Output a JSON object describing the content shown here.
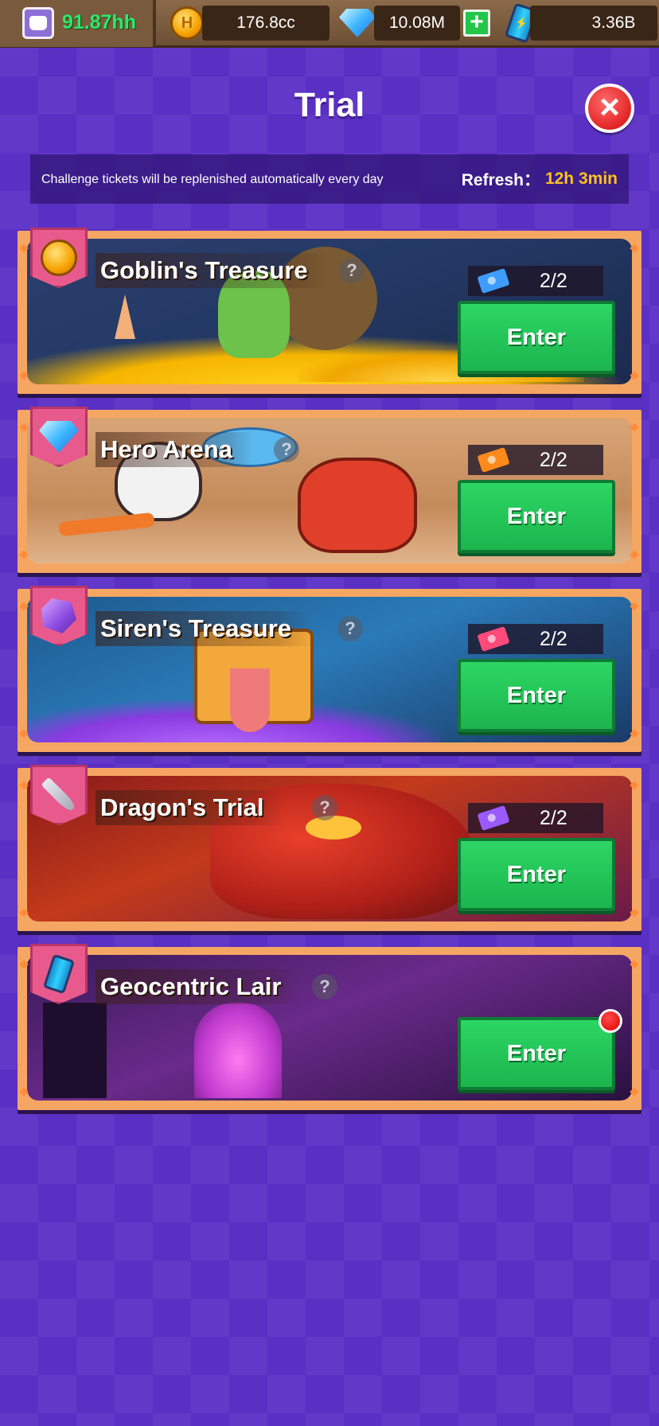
{
  "top_bar": {
    "power": "91.87hh",
    "coins": "176.8cc",
    "gems": "10.08M",
    "energy": "3.36B",
    "colors": {
      "power": "#2de86a"
    }
  },
  "header": {
    "title": "Trial",
    "info": "Challenge tickets will be replenished automatically every day",
    "refresh_label": "Refresh：",
    "refresh_time": "12h 3min"
  },
  "cards": [
    {
      "title": "Goblin's Treasure",
      "tickets": "2/2",
      "enter_label": "Enter",
      "badge_icon": "coin-icon",
      "ticket_color": "#3f9cff"
    },
    {
      "title": "Hero Arena",
      "tickets": "2/2",
      "enter_label": "Enter",
      "badge_icon": "gem-icon",
      "ticket_color": "#ff8a1a"
    },
    {
      "title": "Siren's Treasure",
      "tickets": "2/2",
      "enter_label": "Enter",
      "badge_icon": "crystal-icon",
      "ticket_color": "#ff4a7a"
    },
    {
      "title": "Dragon's Trial",
      "tickets": "2/2",
      "enter_label": "Enter",
      "badge_icon": "sword-icon",
      "ticket_color": "#9a5aff"
    },
    {
      "title": "Geocentric Lair",
      "enter_label": "Enter",
      "badge_icon": "energy-can-icon",
      "has_notification": true
    }
  ]
}
